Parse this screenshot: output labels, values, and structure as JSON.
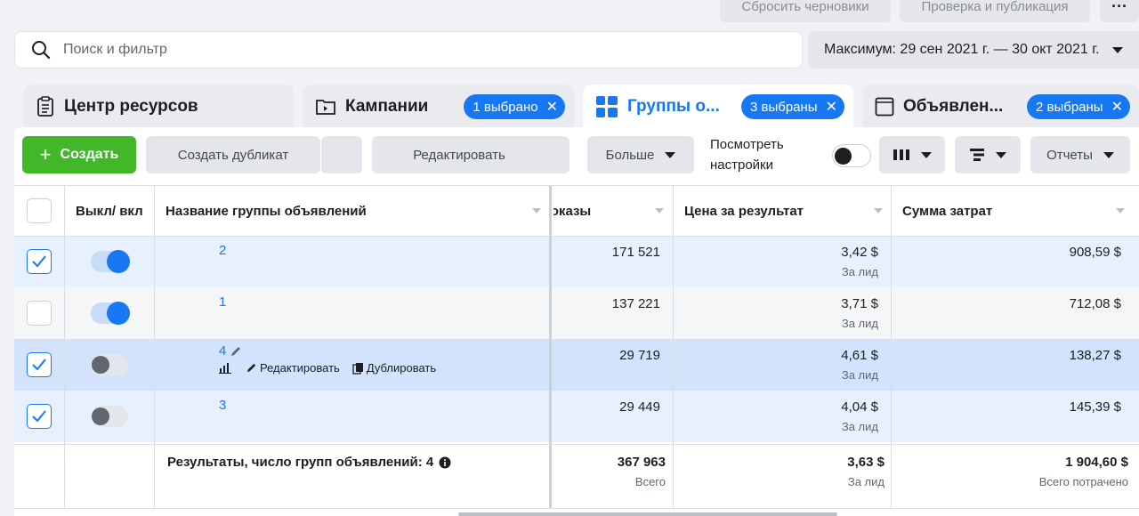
{
  "top_actions": {
    "reset_label": "Сбросить черновики",
    "publish_label": "Проверка и публикация",
    "more_label": "···"
  },
  "search": {
    "placeholder": "Поиск и фильтр"
  },
  "date_range": {
    "label": "Максимум: 29 сен 2021 г. — 30 окт 2021 г."
  },
  "tabs": [
    {
      "label": "Центр ресурсов",
      "icon": "clipboard-icon"
    },
    {
      "label": "Кампании",
      "icon": "folder-icon",
      "chip": "1 выбрано"
    },
    {
      "label": "Группы о...",
      "icon": "grid-icon",
      "chip": "3 выбраны",
      "active": true
    },
    {
      "label": "Объявлен...",
      "icon": "ad-icon",
      "chip": "2 выбраны"
    }
  ],
  "toolbar": {
    "create_label": "Создать",
    "duplicate_label": "Создать дубликат",
    "edit_label": "Редактировать",
    "more_label": "Больше",
    "view_settings_label": "Посмотреть настройки",
    "reports_label": "Отчеты"
  },
  "table": {
    "headers": {
      "toggle": "Выкл/ вкл",
      "name": "Название группы объявлений",
      "impressions": "Показы",
      "cost_per_result": "Цена за результат",
      "amount_spent": "Сумма затрат"
    },
    "rows": [
      {
        "checked": true,
        "on": true,
        "name": "2",
        "impressions": "171 521",
        "cpr": "3,42 $",
        "cpr_sub": "За лид",
        "spent": "908,59 $"
      },
      {
        "checked": false,
        "on": true,
        "name": "1",
        "impressions": "137 221",
        "cpr": "3,71 $",
        "cpr_sub": "За лид",
        "spent": "712,08 $"
      },
      {
        "checked": true,
        "on": false,
        "name": "4",
        "impressions": "29 719",
        "cpr": "4,61 $",
        "cpr_sub": "За лид",
        "spent": "138,27 $",
        "actions": {
          "edit": "Редактировать",
          "duplicate": "Дублировать"
        }
      },
      {
        "checked": true,
        "on": false,
        "name": "3",
        "impressions": "29 449",
        "cpr": "4,04 $",
        "cpr_sub": "За лид",
        "spent": "145,39 $"
      }
    ],
    "footer": {
      "label": "Результаты, число групп объявлений: 4",
      "impressions": "367 963",
      "impressions_sub": "Всего",
      "cpr": "3,63 $",
      "cpr_sub": "За лид",
      "spent": "1 904,60 $",
      "spent_sub": "Всего потрачено"
    }
  },
  "colors": {
    "accent": "#1877f2",
    "create": "#42b72a",
    "selected_row": "#e7f0fd",
    "highlight_row": "#d3e3fb"
  }
}
